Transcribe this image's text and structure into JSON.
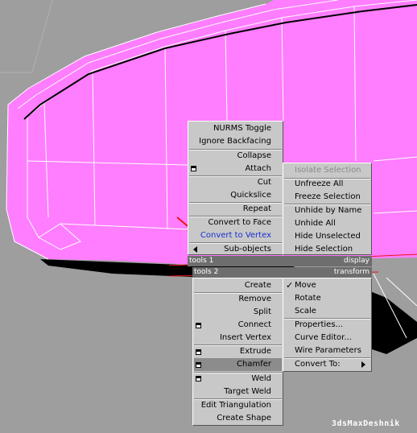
{
  "menus": {
    "tools1": {
      "items": [
        {
          "label": "NURMS Toggle"
        },
        {
          "label": "Ignore Backfacing"
        },
        {
          "label": "Collapse"
        },
        {
          "label": "Attach"
        },
        {
          "label": "Cut"
        },
        {
          "label": "Quickslice"
        },
        {
          "label": "Repeat"
        },
        {
          "label": "Convert to Face"
        },
        {
          "label": "Convert to Vertex"
        },
        {
          "label": "Sub-objects"
        }
      ],
      "quad_label": "tools 1"
    },
    "tools2": {
      "items": [
        {
          "label": "Create"
        },
        {
          "label": "Remove"
        },
        {
          "label": "Split"
        },
        {
          "label": "Connect"
        },
        {
          "label": "Insert Vertex"
        },
        {
          "label": "Extrude"
        },
        {
          "label": "Chamfer"
        },
        {
          "label": "Weld"
        },
        {
          "label": "Target Weld"
        },
        {
          "label": "Edit Triangulation"
        },
        {
          "label": "Create Shape"
        }
      ],
      "quad_label": "tools 2"
    },
    "display": {
      "items": [
        {
          "label": "Isolate Selection"
        },
        {
          "label": "Unfreeze All"
        },
        {
          "label": "Freeze Selection"
        },
        {
          "label": "Unhide by Name"
        },
        {
          "label": "Unhide All"
        },
        {
          "label": "Hide Unselected"
        },
        {
          "label": "Hide Selection"
        }
      ],
      "quad_label": "display"
    },
    "transform": {
      "items": [
        {
          "label": "Move"
        },
        {
          "label": "Rotate"
        },
        {
          "label": "Scale"
        },
        {
          "label": "Properties..."
        },
        {
          "label": "Curve Editor..."
        },
        {
          "label": "Wire Parameters"
        },
        {
          "label": "Convert To:"
        }
      ],
      "quad_label": "transform"
    }
  },
  "watermark": "3dsMaxDeshnik",
  "colors": {
    "mesh_fill": "#ff7dff",
    "background": "#9e9e9e",
    "highlight_text": "#1a2fd0",
    "annotation_arrow": "#e8141e"
  }
}
